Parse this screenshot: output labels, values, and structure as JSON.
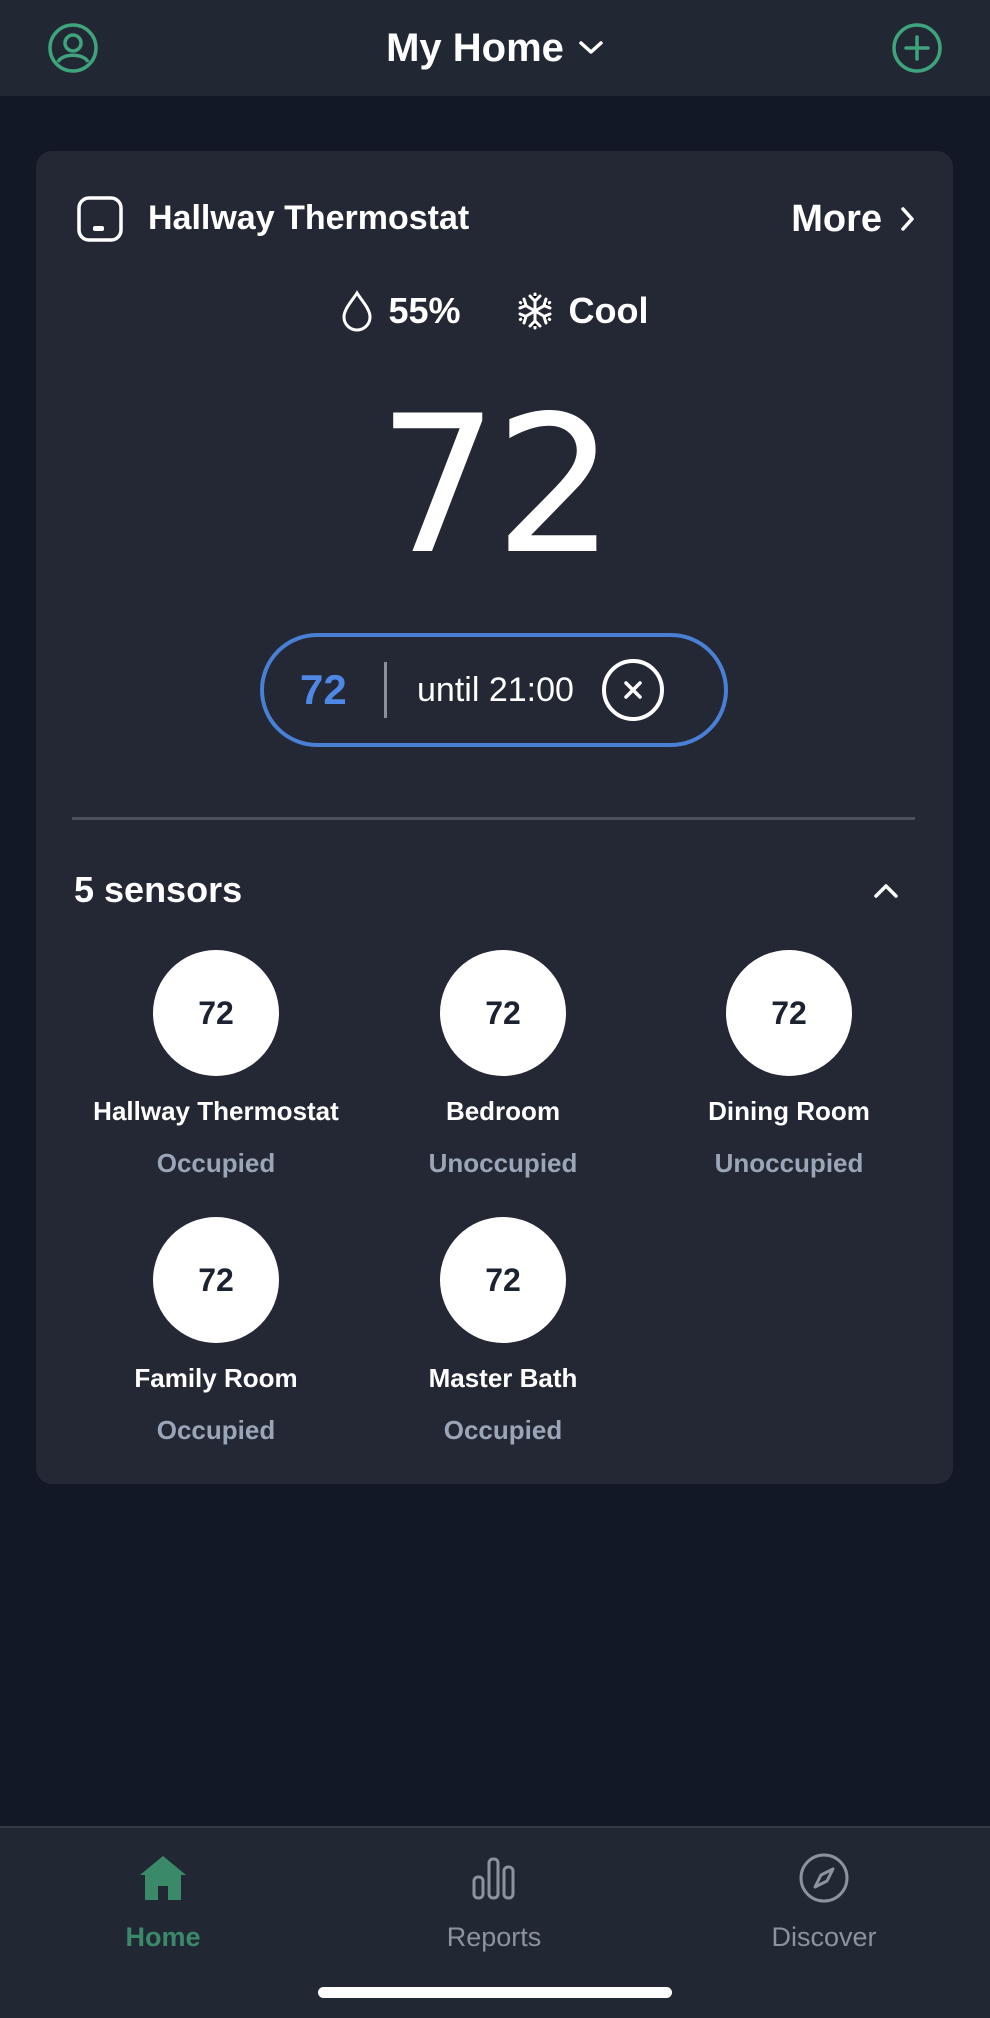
{
  "header": {
    "title": "My Home",
    "profile_icon": "user-circle-icon",
    "add_icon": "plus-circle-icon",
    "accent": "#3fa37c"
  },
  "thermostat": {
    "name": "Hallway Thermostat",
    "more_label": "More",
    "humidity": "55%",
    "mode": "Cool",
    "current_temp": "72",
    "hold": {
      "temp": "72",
      "until": "until 21:00",
      "accent": "#4f87e4"
    }
  },
  "sensors": {
    "title": "5 sensors",
    "items": [
      {
        "name": "Hallway Thermostat",
        "temp": "72",
        "occupancy": "Occupied"
      },
      {
        "name": "Bedroom",
        "temp": "72",
        "occupancy": "Unoccupied"
      },
      {
        "name": "Dining Room",
        "temp": "72",
        "occupancy": "Unoccupied"
      },
      {
        "name": "Family Room",
        "temp": "72",
        "occupancy": "Occupied"
      },
      {
        "name": "Master Bath",
        "temp": "72",
        "occupancy": "Occupied"
      }
    ]
  },
  "nav": {
    "items": [
      {
        "label": "Home",
        "icon": "home-icon",
        "active": true
      },
      {
        "label": "Reports",
        "icon": "bar-chart-icon",
        "active": false
      },
      {
        "label": "Discover",
        "icon": "compass-icon",
        "active": false
      }
    ],
    "active_color": "#3a8a6a",
    "inactive_color": "#8d939d"
  }
}
